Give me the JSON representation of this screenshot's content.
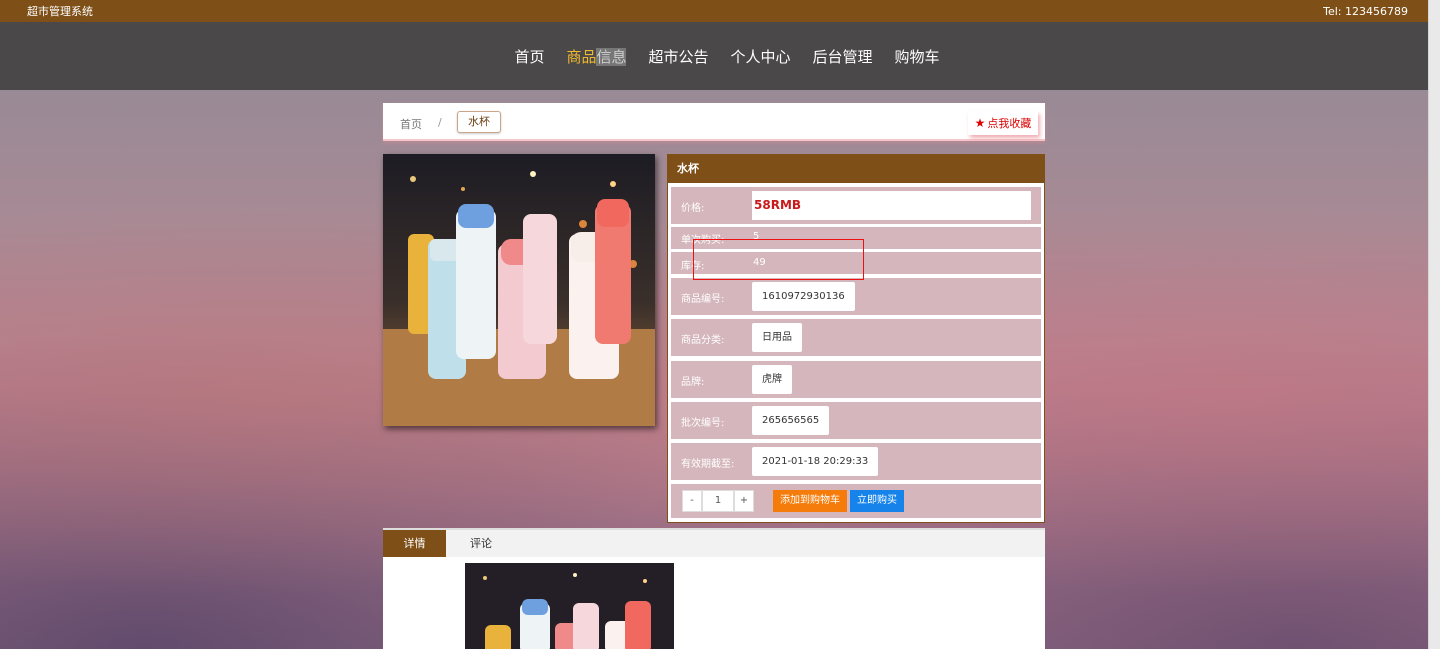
{
  "topbar": {
    "system_name": "超市管理系统",
    "tel": "Tel:  123456789"
  },
  "nav": {
    "home": "首页",
    "goods_a": "商品",
    "goods_b": "信息",
    "notice": "超市公告",
    "personal": "个人中心",
    "admin": "后台管理",
    "cart": "购物车"
  },
  "breadcrumb": {
    "home": "首页",
    "sep": "/",
    "current": "水杯"
  },
  "favorite": {
    "label": "点我收藏",
    "icon": "star-icon"
  },
  "product": {
    "title": "水杯",
    "price_label": "价格:",
    "price": "58RMB",
    "single_limit_label": "单次购买:",
    "single_limit": "5",
    "stock_label": "库存:",
    "stock": "49",
    "code_label": "商品编号:",
    "code": "1610972930136",
    "category_label": "商品分类:",
    "category": "日用品",
    "brand_label": "品牌:",
    "brand": "虎牌",
    "batch_label": "批次编号:",
    "batch": "265656565",
    "expiry_label": "有效期截至:",
    "expiry": "2021-01-18 20:29:33"
  },
  "quantity": {
    "minus": "-",
    "value": "1",
    "plus": "+"
  },
  "actions": {
    "add_to_cart": "添加到购物车",
    "buy_now": "立即购买"
  },
  "tabs": {
    "detail": "详情",
    "comment": "评论"
  },
  "colors": {
    "brand": "#7e4f17",
    "price": "#c81a1a",
    "cart_btn": "#f57c0a",
    "buy_btn": "#1583ea",
    "row_bg": "#d4b6bc"
  }
}
